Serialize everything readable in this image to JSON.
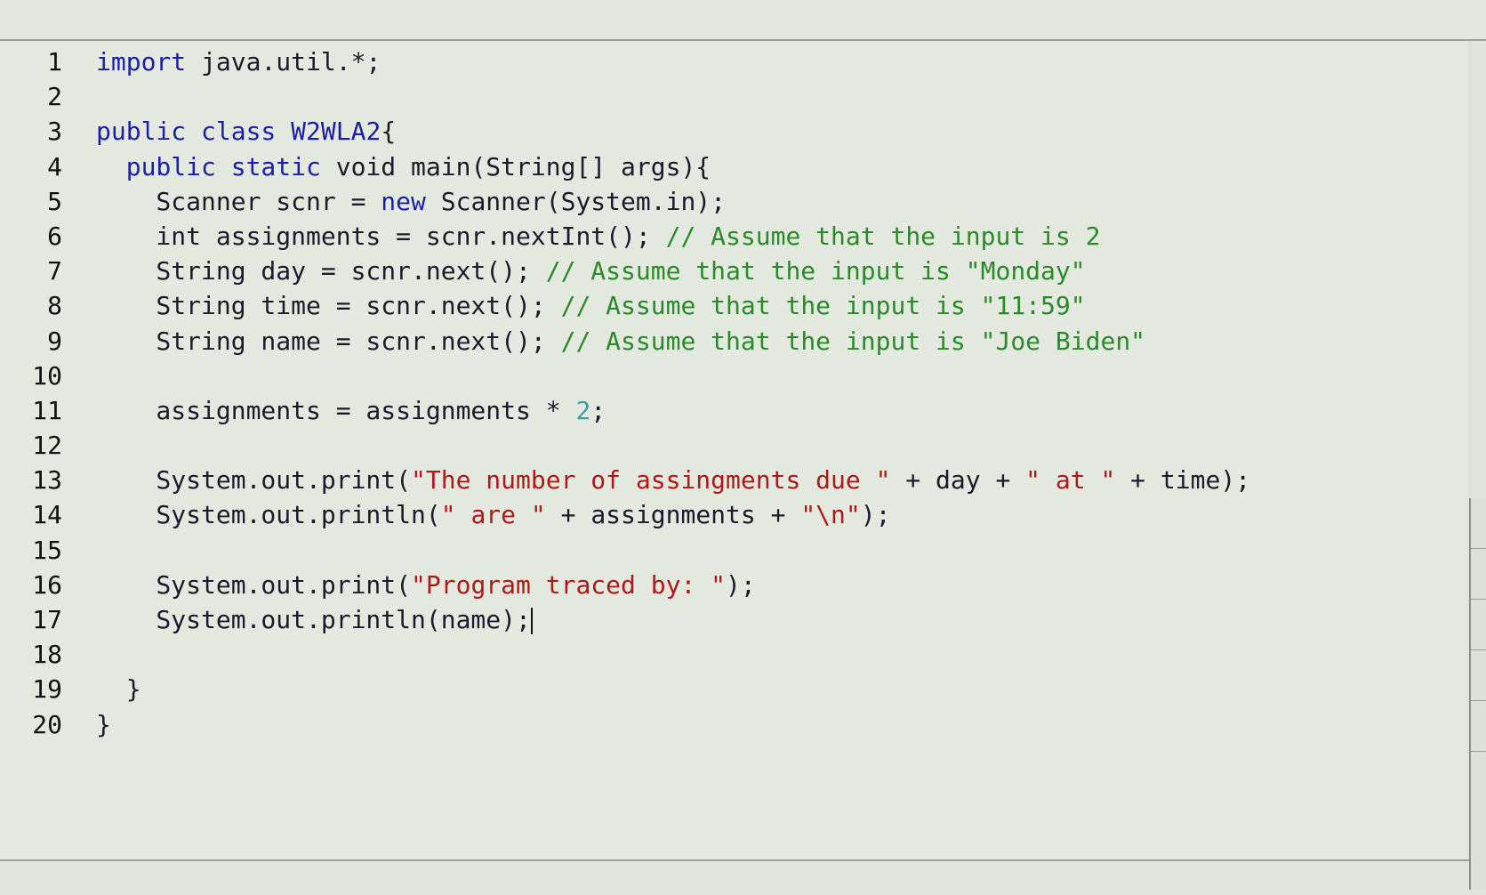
{
  "editor": {
    "language": "java",
    "cursor_line": 17,
    "lines": [
      {
        "n": "1",
        "tokens": [
          {
            "t": "kw",
            "v": "import"
          },
          {
            "t": "tx",
            "v": " java.util.*;"
          }
        ]
      },
      {
        "n": "2",
        "tokens": []
      },
      {
        "n": "3",
        "tokens": [
          {
            "t": "kw",
            "v": "public class"
          },
          {
            "t": "tx",
            "v": " "
          },
          {
            "t": "kw",
            "v": "W2WLA2"
          },
          {
            "t": "tx",
            "v": "{"
          }
        ]
      },
      {
        "n": "4",
        "tokens": [
          {
            "t": "tx",
            "v": "  "
          },
          {
            "t": "kw",
            "v": "public static"
          },
          {
            "t": "tx",
            "v": " void main(String[] args){"
          }
        ]
      },
      {
        "n": "5",
        "tokens": [
          {
            "t": "tx",
            "v": "    Scanner scnr = "
          },
          {
            "t": "kw",
            "v": "new"
          },
          {
            "t": "tx",
            "v": " Scanner(System.in);"
          }
        ]
      },
      {
        "n": "6",
        "tokens": [
          {
            "t": "tx",
            "v": "    int assignments = scnr.nextInt(); "
          },
          {
            "t": "cm",
            "v": "// Assume that the input is 2"
          }
        ]
      },
      {
        "n": "7",
        "tokens": [
          {
            "t": "tx",
            "v": "    String day = scnr.next(); "
          },
          {
            "t": "cm",
            "v": "// Assume that the input is \"Monday\""
          }
        ]
      },
      {
        "n": "8",
        "tokens": [
          {
            "t": "tx",
            "v": "    String time = scnr.next(); "
          },
          {
            "t": "cm",
            "v": "// Assume that the input is \"11:59\""
          }
        ]
      },
      {
        "n": "9",
        "tokens": [
          {
            "t": "tx",
            "v": "    String name = scnr.next(); "
          },
          {
            "t": "cm",
            "v": "// Assume that the input is \"Joe Biden\""
          }
        ]
      },
      {
        "n": "10",
        "tokens": []
      },
      {
        "n": "11",
        "tokens": [
          {
            "t": "tx",
            "v": "    assignments = assignments * "
          },
          {
            "t": "num",
            "v": "2"
          },
          {
            "t": "tx",
            "v": ";"
          }
        ]
      },
      {
        "n": "12",
        "tokens": []
      },
      {
        "n": "13",
        "tokens": [
          {
            "t": "tx",
            "v": "    System.out.print("
          },
          {
            "t": "st",
            "v": "\"The number of assingments due \""
          },
          {
            "t": "tx",
            "v": " + day + "
          },
          {
            "t": "st",
            "v": "\" at \""
          },
          {
            "t": "tx",
            "v": " + time);"
          }
        ]
      },
      {
        "n": "14",
        "tokens": [
          {
            "t": "tx",
            "v": "    System.out.println("
          },
          {
            "t": "st",
            "v": "\" are \""
          },
          {
            "t": "tx",
            "v": " + assignments + "
          },
          {
            "t": "st",
            "v": "\"\\n\""
          },
          {
            "t": "tx",
            "v": ");"
          }
        ]
      },
      {
        "n": "15",
        "tokens": []
      },
      {
        "n": "16",
        "tokens": [
          {
            "t": "tx",
            "v": "    System.out.print("
          },
          {
            "t": "st",
            "v": "\"Program traced by: \""
          },
          {
            "t": "tx",
            "v": ");"
          }
        ]
      },
      {
        "n": "17",
        "tokens": [
          {
            "t": "tx",
            "v": "    System.out.println(name);"
          }
        ]
      },
      {
        "n": "18",
        "tokens": []
      },
      {
        "n": "19",
        "tokens": [
          {
            "t": "tx",
            "v": "  }"
          }
        ]
      },
      {
        "n": "20",
        "tokens": [
          {
            "t": "tx",
            "v": "}"
          }
        ]
      }
    ]
  }
}
